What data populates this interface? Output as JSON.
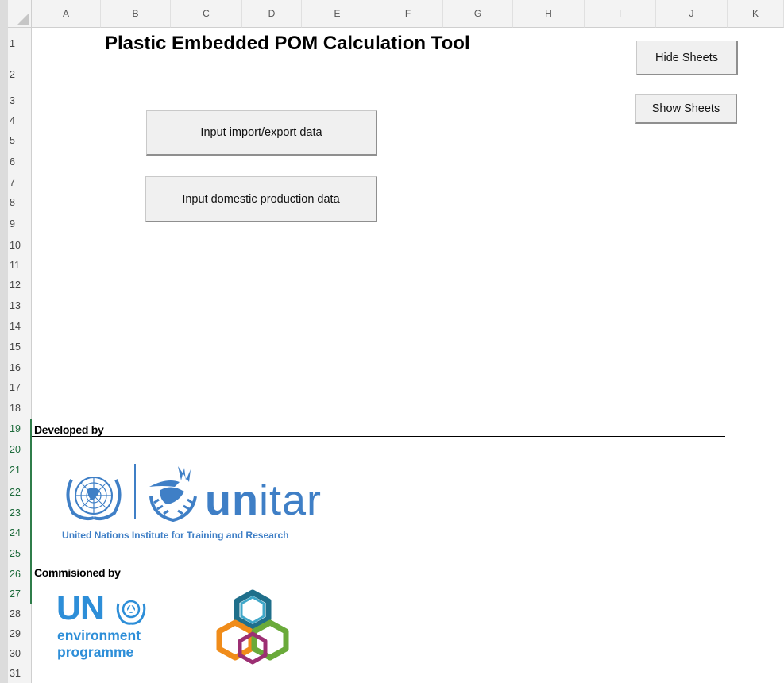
{
  "sheet": {
    "columns": [
      "A",
      "B",
      "C",
      "D",
      "E",
      "F",
      "G",
      "H",
      "I",
      "J",
      "K"
    ],
    "rows": [
      "1",
      "2",
      "3",
      "4",
      "5",
      "6",
      "7",
      "8",
      "9",
      "10",
      "11",
      "12",
      "13",
      "14",
      "15",
      "16",
      "17",
      "18",
      "19",
      "20",
      "21",
      "22",
      "23",
      "24",
      "25",
      "26",
      "27",
      "28",
      "29",
      "30",
      "31"
    ]
  },
  "title": "Plastic Embedded POM Calculation Tool",
  "buttons": {
    "import_export": "Input import/export data",
    "domestic": "Input domestic production data",
    "hide": "Hide Sheets",
    "show": "Show Sheets"
  },
  "developed_by": "Developed by",
  "commissioned_by": "Commisioned by",
  "logos": {
    "unitar_wordmark_un": "un",
    "unitar_wordmark_itar": "itar",
    "unitar_subtitle": "United Nations Institute for Training and Research",
    "unep_un": "UN",
    "unep_line1": "environment",
    "unep_line2": "programme"
  },
  "colors": {
    "unitar_blue": "#3f7fc6",
    "unep_blue": "#2d8ed8",
    "selected_row_green": "#2f7d4a"
  }
}
